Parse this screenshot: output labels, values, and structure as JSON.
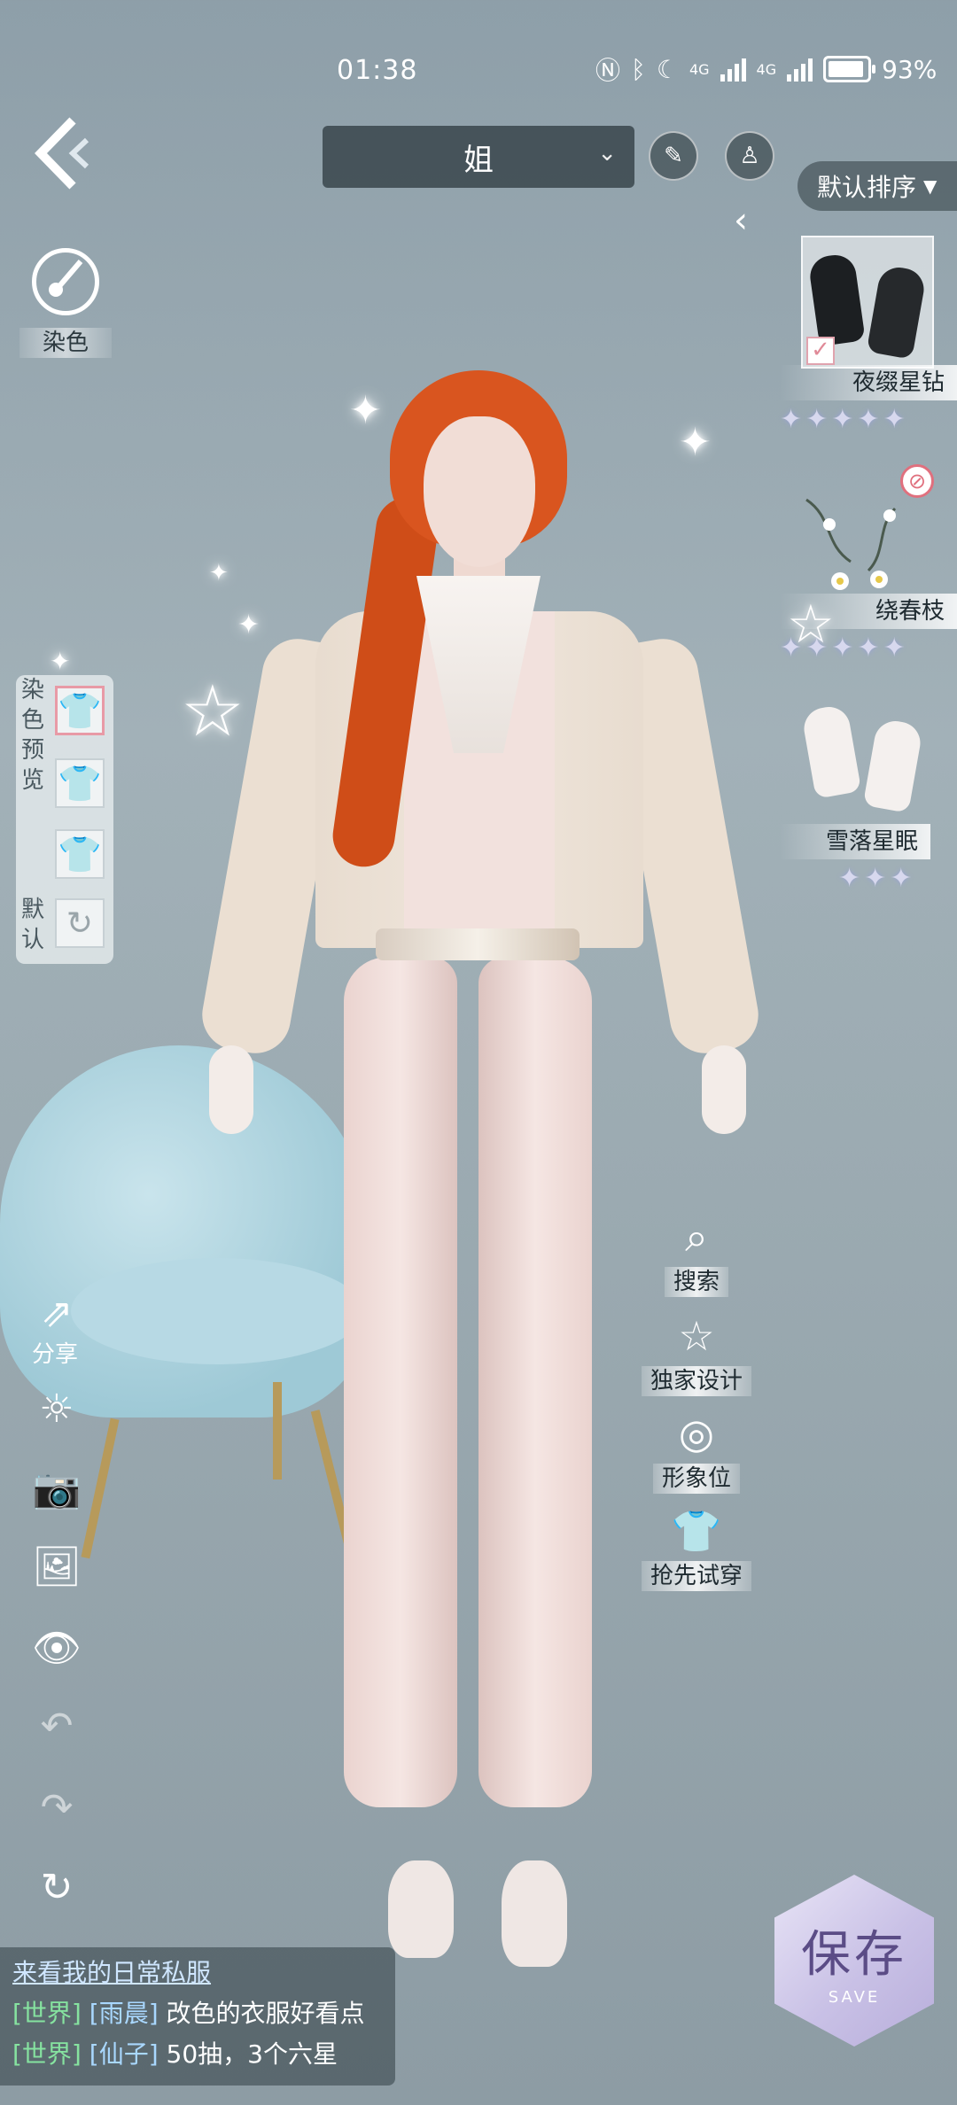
{
  "status_bar": {
    "time": "01:38",
    "net1": "4G",
    "net2": "4G",
    "battery_percent": "93%",
    "battery_level": 0.93
  },
  "top": {
    "character_select": "姐",
    "sort_label": "默认排序"
  },
  "left_panel": {
    "dye_label": "染色",
    "dye_preview_title": "染色预览",
    "dye_default_label": "默认"
  },
  "items": [
    {
      "name": "夜缀星钻",
      "stars": 5,
      "selected": true
    },
    {
      "name": "绕春枝",
      "stars": 5,
      "selected": false
    },
    {
      "name": "雪落星眠",
      "stars": 3,
      "selected": false
    }
  ],
  "actions": {
    "search": "搜索",
    "exclusive_design": "独家设计",
    "image_position": "形象位",
    "try_first": "抢先试穿"
  },
  "tools": {
    "share": "分享"
  },
  "chat": {
    "link": "来看我的日常私服",
    "messages": [
      {
        "channel": "[世界]",
        "user": "[雨晨]",
        "text": "改色的衣服好看点"
      },
      {
        "channel": "[世界]",
        "user": "[仙子]",
        "text": "50抽，3个六星"
      }
    ]
  },
  "save": {
    "label": "保存",
    "label_en": "SAVE"
  },
  "colors": {
    "background": "#9aa9b0",
    "hair": "#d9551f",
    "chair": "#b7d9e4",
    "save_button": "#c9c1e6",
    "chat_channel": "#86e3a0"
  }
}
